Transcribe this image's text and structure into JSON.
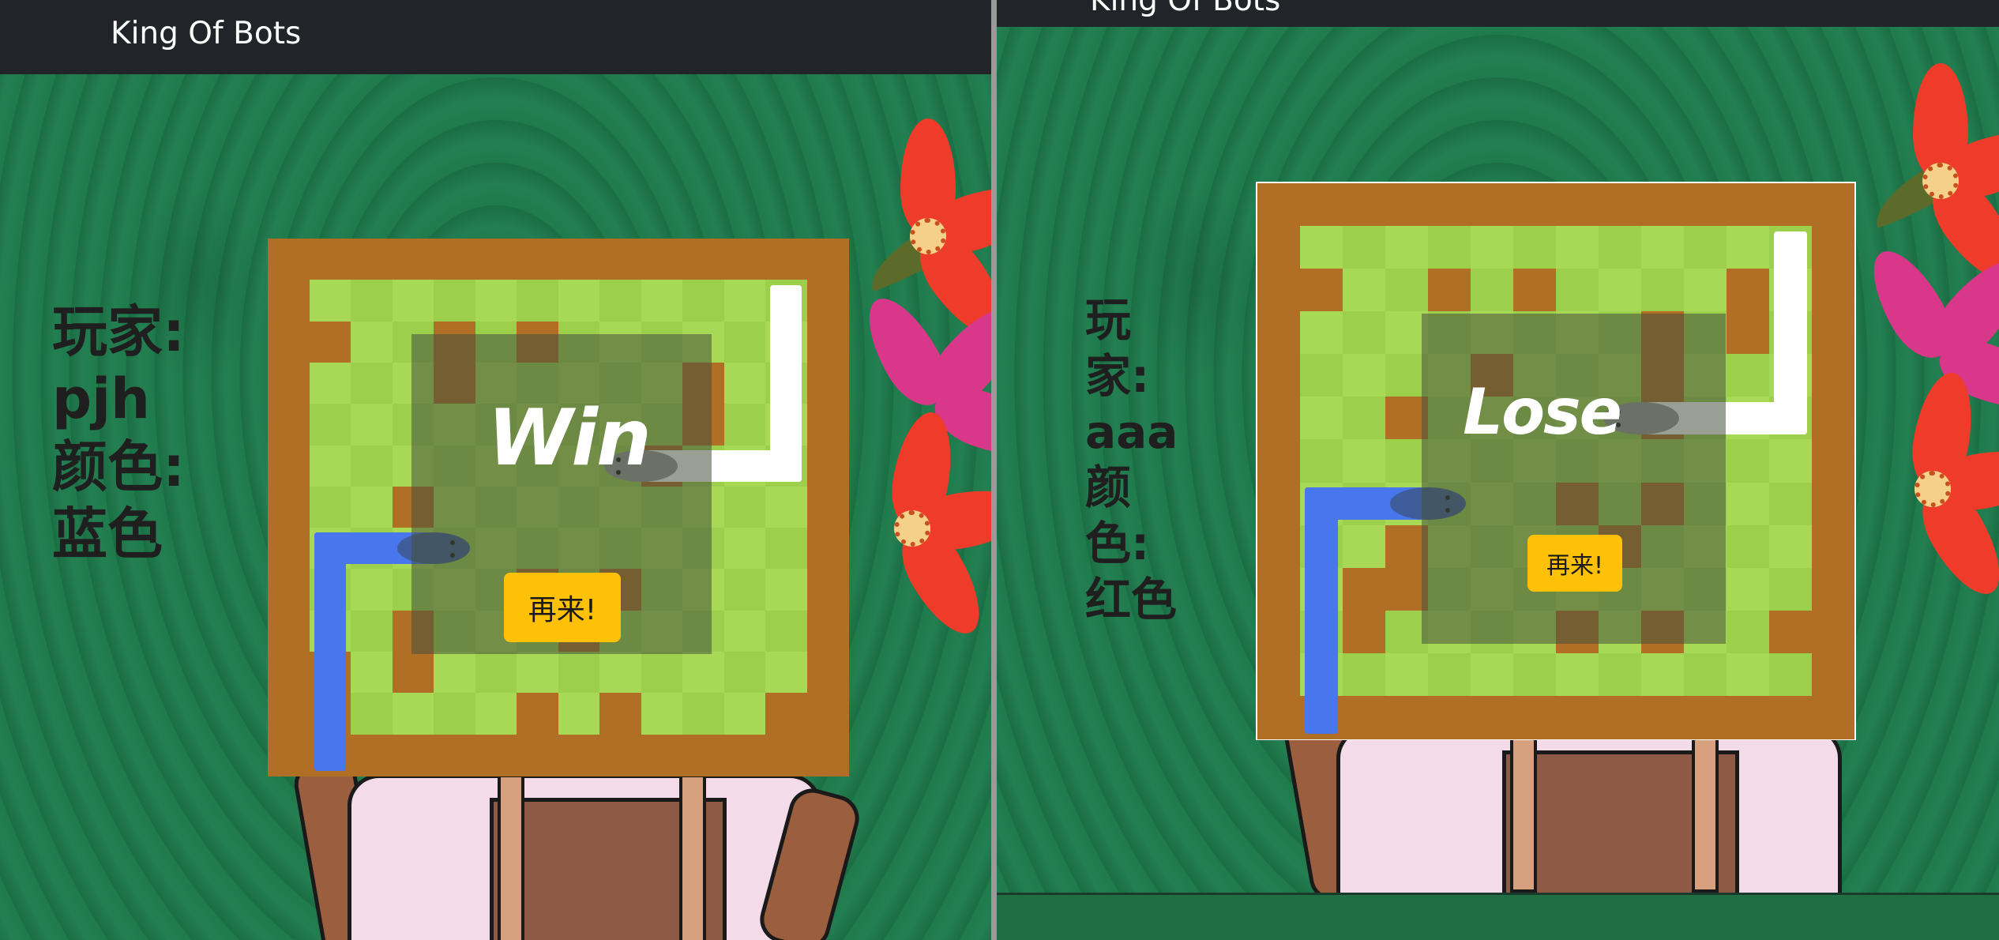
{
  "app": {
    "brand": "King Of Bots"
  },
  "colors": {
    "navbar": "#212529",
    "wall": "#b06f25",
    "grass_light": "#a8d956",
    "grass_dark": "#9cd04c",
    "blue_snake": "#4876ec",
    "white_snake": "#ffffff",
    "restart_button": "#ffc107",
    "background": "#1f7a4c"
  },
  "left_window": {
    "player": {
      "label": "玩家:",
      "name": "pjh"
    },
    "color": {
      "label": "颜色:",
      "value": "蓝色"
    },
    "result": "Win",
    "restart_label": "再来!"
  },
  "right_window": {
    "player": {
      "label": "玩家:",
      "name": "aaa"
    },
    "color": {
      "label": "颜色:",
      "value": "红色"
    },
    "result": "Lose",
    "restart_label": "再来!"
  },
  "game": {
    "rows": 13,
    "cols": 14,
    "interior_walls_left": [
      [
        2,
        1
      ],
      [
        2,
        4
      ],
      [
        2,
        6
      ],
      [
        3,
        4
      ],
      [
        3,
        10
      ],
      [
        4,
        10
      ],
      [
        5,
        9
      ],
      [
        6,
        3
      ],
      [
        8,
        6
      ],
      [
        8,
        8
      ],
      [
        9,
        3
      ],
      [
        9,
        7
      ],
      [
        10,
        1
      ],
      [
        10,
        3
      ],
      [
        11,
        1
      ],
      [
        11,
        6
      ],
      [
        11,
        8
      ],
      [
        11,
        12
      ]
    ],
    "interior_walls_right": [
      [
        2,
        1
      ],
      [
        2,
        4
      ],
      [
        2,
        6
      ],
      [
        2,
        11
      ],
      [
        3,
        9
      ],
      [
        3,
        11
      ],
      [
        4,
        5
      ],
      [
        4,
        9
      ],
      [
        5,
        3
      ],
      [
        5,
        9
      ],
      [
        7,
        7
      ],
      [
        7,
        9
      ],
      [
        8,
        3
      ],
      [
        8,
        8
      ],
      [
        9,
        2
      ],
      [
        9,
        3
      ],
      [
        10,
        2
      ],
      [
        10,
        7
      ],
      [
        10,
        9
      ],
      [
        10,
        12
      ]
    ],
    "snakes": [
      {
        "name": "blue",
        "color": "#4876ec",
        "cells": [
          [
            12,
            1
          ],
          [
            11,
            1
          ],
          [
            10,
            1
          ],
          [
            9,
            1
          ],
          [
            8,
            1
          ],
          [
            7,
            1
          ],
          [
            7,
            2
          ],
          [
            7,
            3
          ],
          [
            7,
            4
          ]
        ],
        "tail_fade": "#3f5d9a"
      },
      {
        "name": "white",
        "color": "#ffffff",
        "cells": [
          [
            1,
            12
          ],
          [
            2,
            12
          ],
          [
            3,
            12
          ],
          [
            4,
            12
          ],
          [
            5,
            12
          ],
          [
            5,
            11
          ],
          [
            5,
            10
          ],
          [
            5,
            9
          ],
          [
            5,
            8
          ]
        ],
        "tail_fade": "#9a9a9a"
      }
    ]
  }
}
